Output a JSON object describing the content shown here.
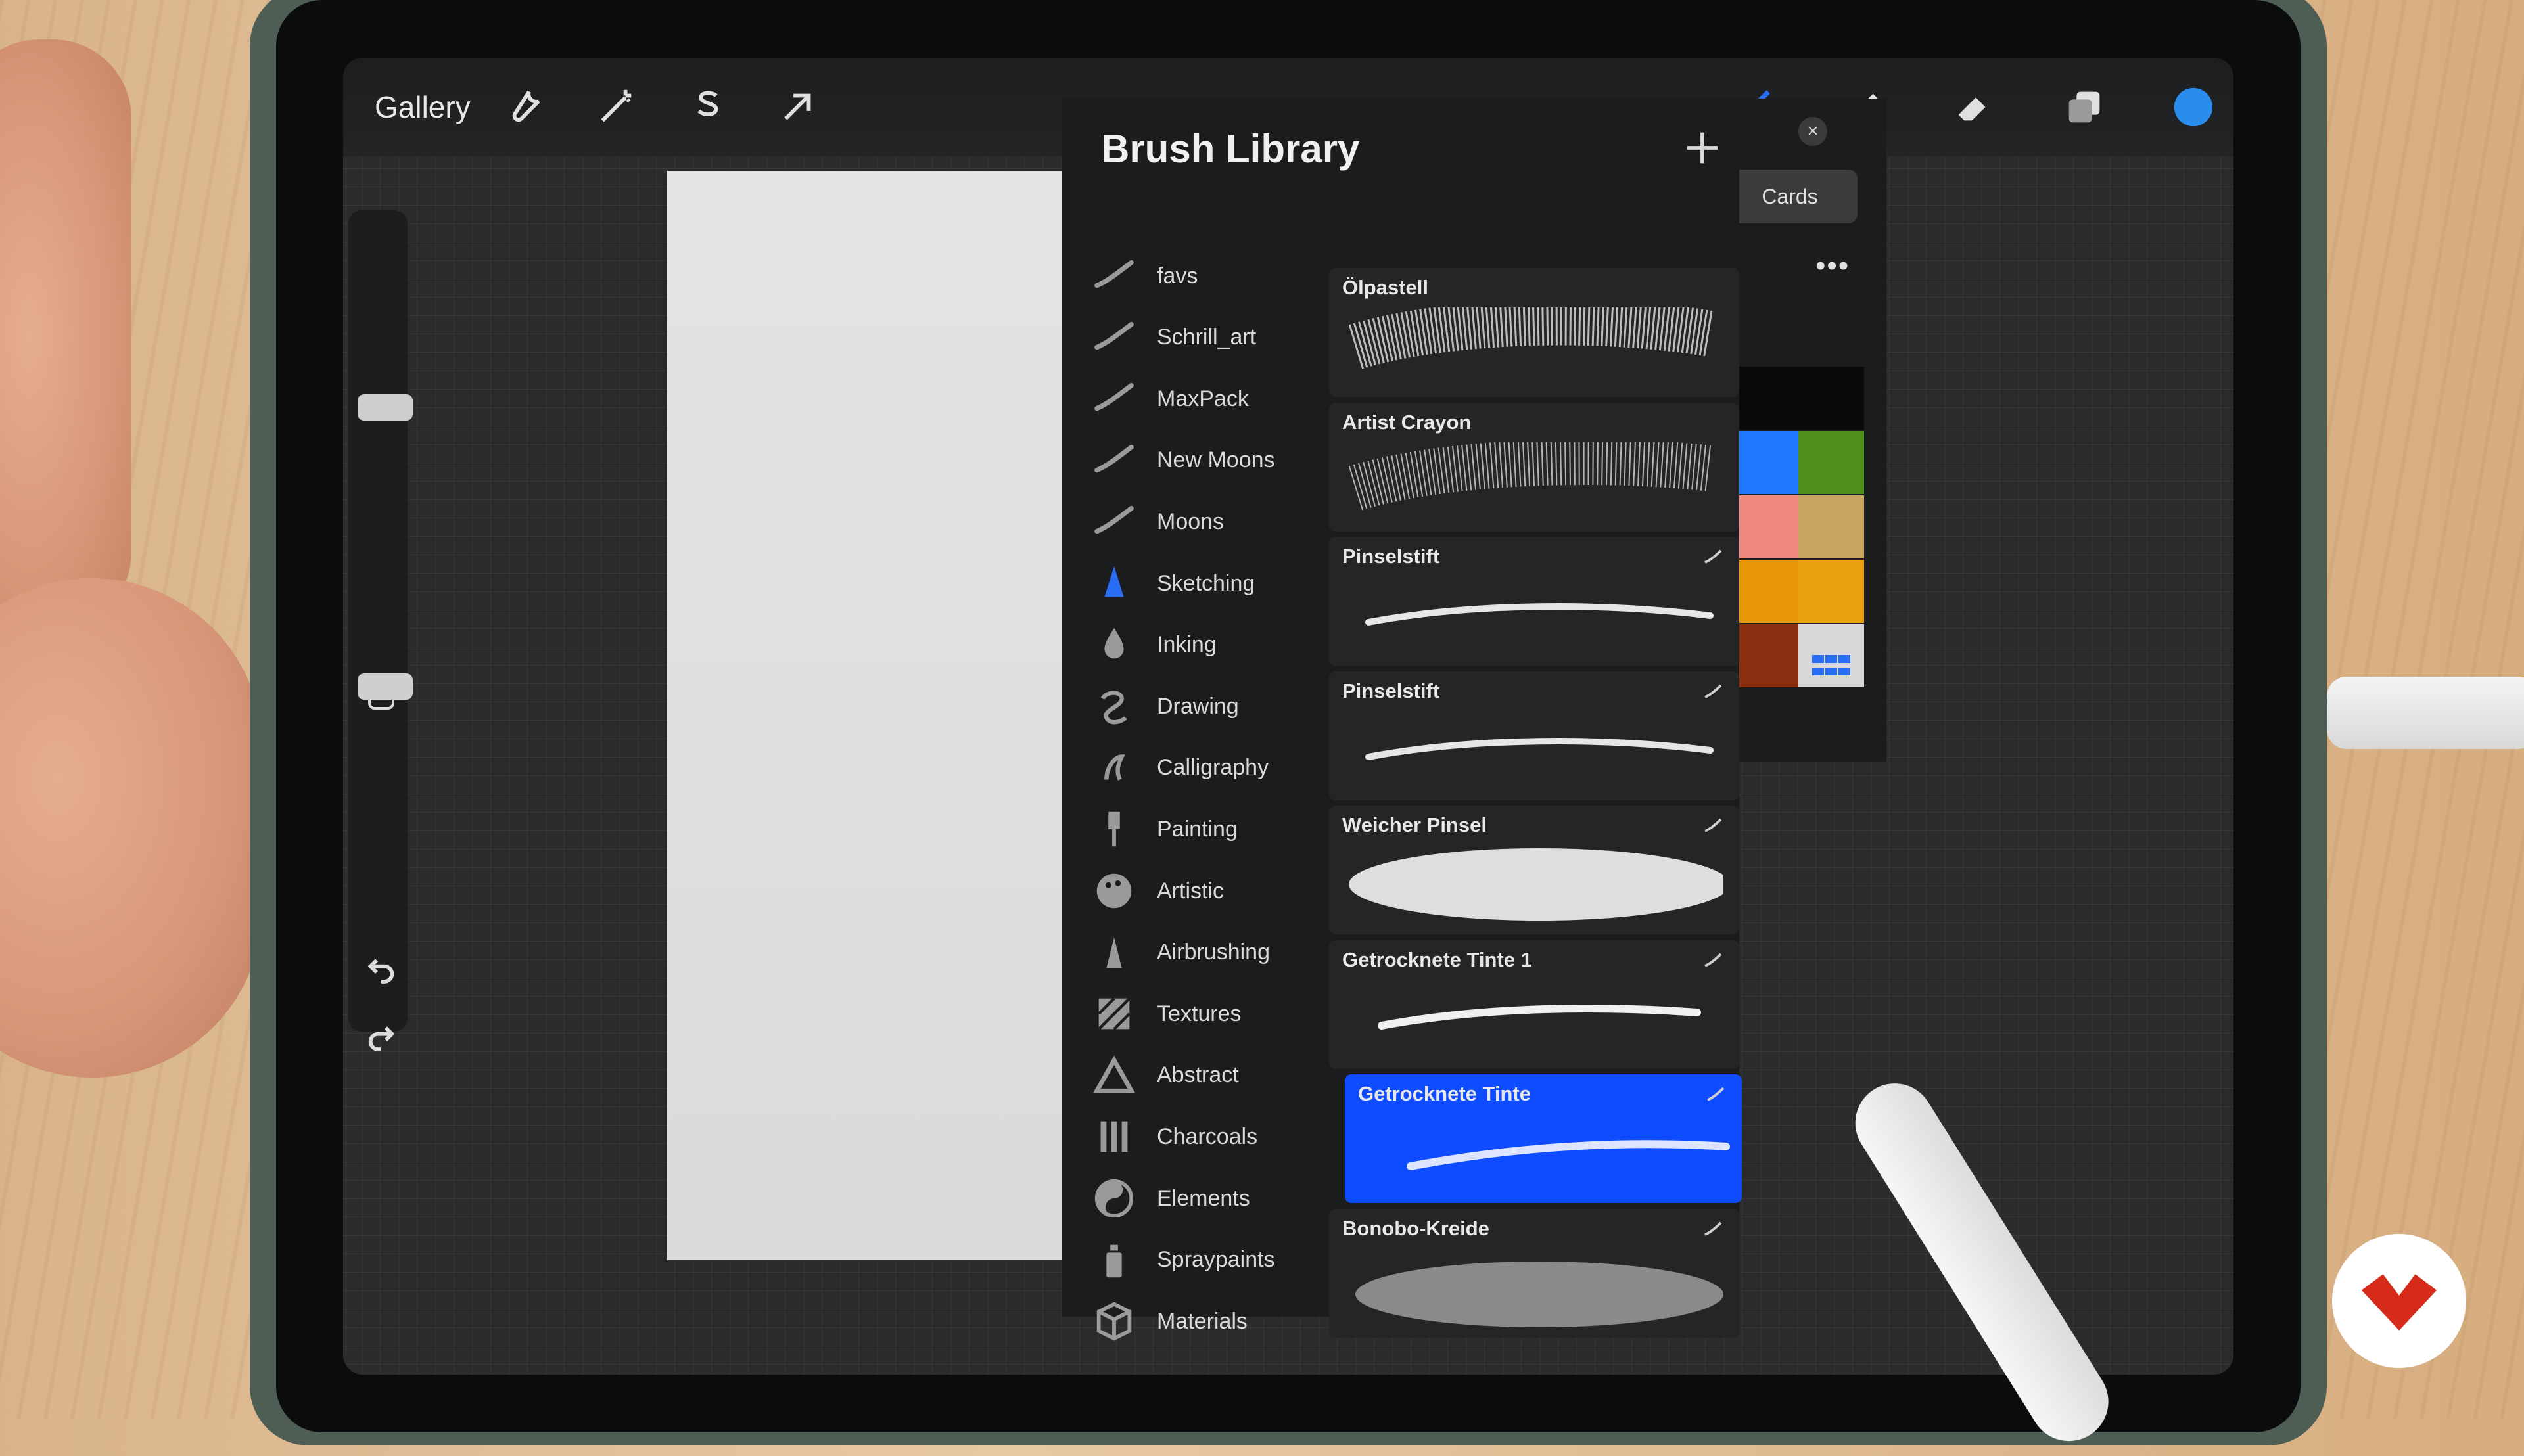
{
  "topbar": {
    "gallery_label": "Gallery",
    "tools_left": [
      "wrench-icon",
      "magic-wand-icon",
      "selection-s-icon",
      "transform-arrow-icon"
    ],
    "tools_right": [
      "brush-icon",
      "smudge-icon",
      "eraser-icon",
      "layers-icon",
      "color-circle-icon"
    ],
    "active_color": "#2a6df5"
  },
  "brush_library": {
    "title": "Brush Library",
    "sets": [
      {
        "label": "favs",
        "icon": "stroke-icon"
      },
      {
        "label": "Schrill_art",
        "icon": "stroke-icon"
      },
      {
        "label": "MaxPack",
        "icon": "stroke-icon"
      },
      {
        "label": "New Moons",
        "icon": "stroke-icon"
      },
      {
        "label": "Moons",
        "icon": "stroke-icon"
      },
      {
        "label": "Sketching",
        "icon": "pencil-tip-icon",
        "active": true
      },
      {
        "label": "Inking",
        "icon": "ink-drop-icon"
      },
      {
        "label": "Drawing",
        "icon": "squiggle-icon"
      },
      {
        "label": "Calligraphy",
        "icon": "calligraphy-a-icon"
      },
      {
        "label": "Painting",
        "icon": "paint-brush-icon"
      },
      {
        "label": "Artistic",
        "icon": "palette-icon"
      },
      {
        "label": "Airbrushing",
        "icon": "airbrush-icon"
      },
      {
        "label": "Textures",
        "icon": "texture-icon"
      },
      {
        "label": "Abstract",
        "icon": "triangle-icon"
      },
      {
        "label": "Charcoals",
        "icon": "charcoal-icon"
      },
      {
        "label": "Elements",
        "icon": "yin-yang-icon"
      },
      {
        "label": "Spraypaints",
        "icon": "spray-can-icon"
      },
      {
        "label": "Materials",
        "icon": "cube-icon"
      }
    ],
    "brushes": [
      {
        "name": "Ölpastell"
      },
      {
        "name": "Artist Crayon"
      },
      {
        "name": "Pinselstift"
      },
      {
        "name": "Pinselstift"
      },
      {
        "name": "Weicher Pinsel"
      },
      {
        "name": "Getrocknete Tinte 1"
      },
      {
        "name": "Getrocknete Tinte",
        "selected": true
      },
      {
        "name": "Bonobo-Kreide"
      }
    ]
  },
  "palette": {
    "cards_label": "Cards",
    "swatches": [
      "#0a0a0a",
      "#0a0a0a",
      "#1f78ff",
      "#4f8f1a",
      "#f08a80",
      "#c8a860",
      "#e8960a",
      "#e8a010",
      "#8a3010",
      "#d8d8d8"
    ]
  },
  "colors": {
    "selection_blue": "#0f4cff",
    "panel_bg": "#1b1c1e"
  }
}
